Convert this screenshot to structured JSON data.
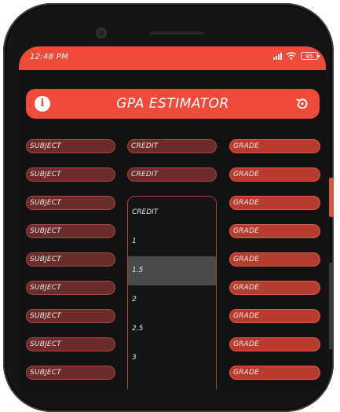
{
  "status_bar": {
    "time": "12:48 PM",
    "battery": "85"
  },
  "app_bar": {
    "title": "GPA ESTIMATOR"
  },
  "rows": {
    "subject_placeholder": "SUBJECT",
    "credit_placeholder": "CREDIT",
    "grade_placeholder": "GRADE"
  },
  "credit_dropdown": {
    "header": "CREDIT",
    "options": [
      "1",
      "1.5",
      "2",
      "2.5",
      "3"
    ],
    "highlighted": "1.5"
  },
  "colors": {
    "accent": "#f04a3a",
    "background": "#121212",
    "pill_dark": "#6a2c2a",
    "pill_grade": "#b83b30"
  },
  "icons": {
    "info": "info-icon",
    "reset": "reset-icon"
  }
}
